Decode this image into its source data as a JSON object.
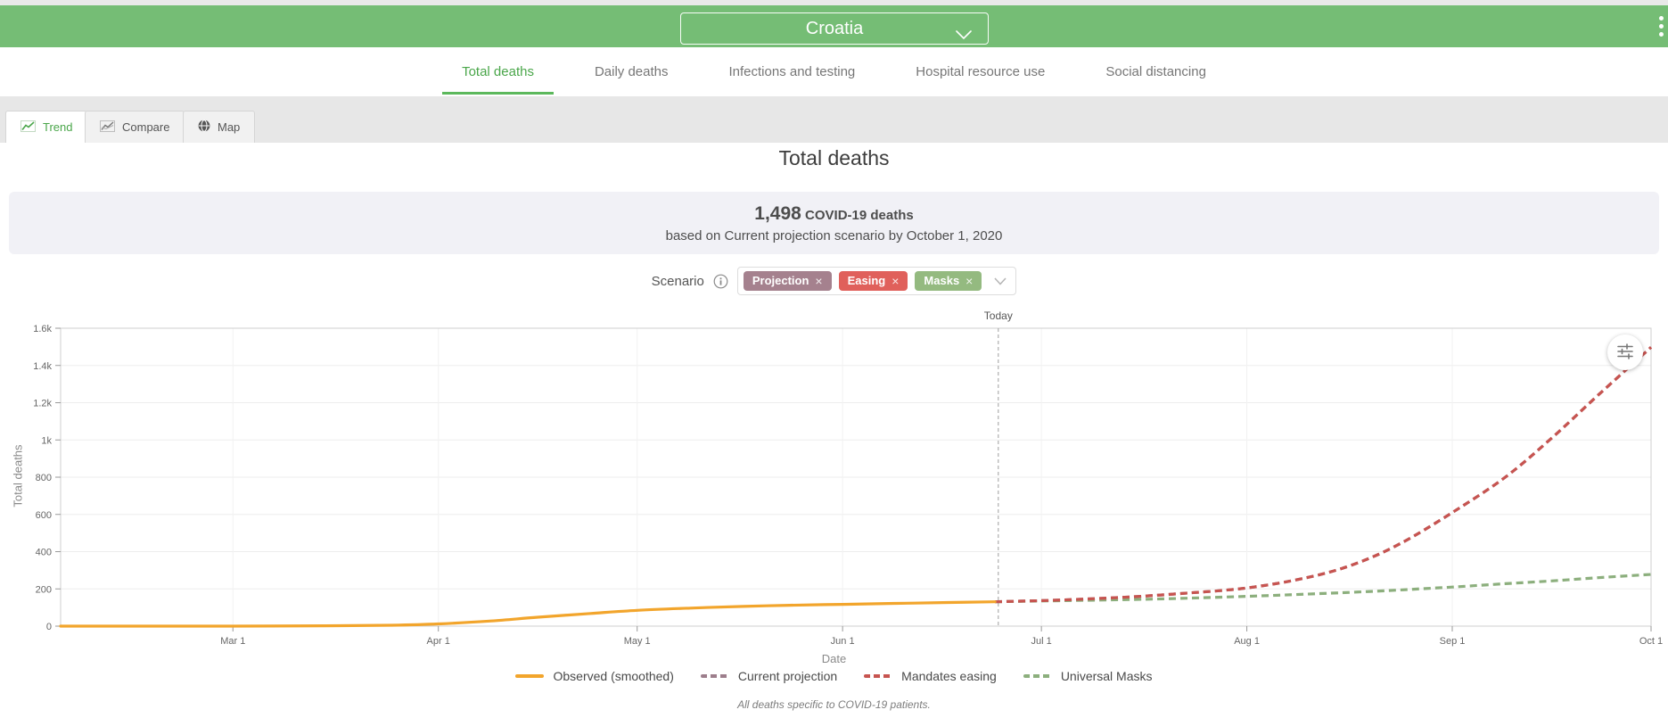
{
  "header": {
    "location_selector": {
      "value": "Croatia"
    }
  },
  "nav_tabs": {
    "items": [
      {
        "label": "Total deaths",
        "active": true
      },
      {
        "label": "Daily deaths",
        "active": false
      },
      {
        "label": "Infections and testing",
        "active": false
      },
      {
        "label": "Hospital resource use",
        "active": false
      },
      {
        "label": "Social distancing",
        "active": false
      }
    ]
  },
  "view_tabs": {
    "items": [
      {
        "label": "Trend",
        "icon": "line-chart-icon",
        "active": true
      },
      {
        "label": "Compare",
        "icon": "compare-chart-icon",
        "active": false
      },
      {
        "label": "Map",
        "icon": "globe-icon",
        "active": false
      }
    ]
  },
  "page": {
    "title": "Total deaths"
  },
  "summary": {
    "value": "1,498",
    "value_label": "COVID-19 deaths",
    "detail": "based on Current projection scenario by October 1, 2020"
  },
  "scenario": {
    "label": "Scenario",
    "close_glyph": "×",
    "tags": [
      {
        "label": "Projection",
        "color": "#a5818e"
      },
      {
        "label": "Easing",
        "color": "#e0605b"
      },
      {
        "label": "Masks",
        "color": "#94ba80"
      }
    ]
  },
  "chart_data": {
    "type": "line",
    "xlabel": "Date",
    "ylabel": "Total deaths",
    "x_unit": "day index (0 = left edge of plot, early Feb 2020)",
    "x_domain_days": [
      0,
      240
    ],
    "ylim": [
      0,
      1600
    ],
    "grid": true,
    "legend_position": "bottom",
    "yticks": [
      {
        "value": 0,
        "label": "0"
      },
      {
        "value": 200,
        "label": "200"
      },
      {
        "value": 400,
        "label": "400"
      },
      {
        "value": 600,
        "label": "600"
      },
      {
        "value": 800,
        "label": "800"
      },
      {
        "value": 1000,
        "label": "1k"
      },
      {
        "value": 1200,
        "label": "1.2k"
      },
      {
        "value": 1400,
        "label": "1.4k"
      },
      {
        "value": 1600,
        "label": "1.6k"
      }
    ],
    "xticks": [
      {
        "day": 26,
        "label": "Mar 1"
      },
      {
        "day": 57,
        "label": "Apr 1"
      },
      {
        "day": 87,
        "label": "May 1"
      },
      {
        "day": 118,
        "label": "Jun 1"
      },
      {
        "day": 148,
        "label": "Jul 1"
      },
      {
        "day": 179,
        "label": "Aug 1"
      },
      {
        "day": 210,
        "label": "Sep 1"
      },
      {
        "day": 240,
        "label": "Oct 1"
      }
    ],
    "today_marker": {
      "day": 141.5,
      "label": "Today"
    },
    "series": [
      {
        "name": "Current projection",
        "color": "#9d7e8c",
        "style": "dashed",
        "points": [
          [
            141,
            131
          ],
          [
            148,
            137
          ],
          [
            155,
            146
          ],
          [
            162,
            158
          ],
          [
            169,
            175
          ],
          [
            179,
            205
          ],
          [
            188,
            260
          ],
          [
            195,
            330
          ],
          [
            202,
            440
          ],
          [
            210,
            610
          ],
          [
            218,
            800
          ],
          [
            225,
            1010
          ],
          [
            232,
            1240
          ],
          [
            240,
            1498
          ]
        ]
      },
      {
        "name": "Universal Masks",
        "color": "#8caf7d",
        "style": "dashed",
        "points": [
          [
            141,
            131
          ],
          [
            148,
            135
          ],
          [
            155,
            139
          ],
          [
            162,
            143
          ],
          [
            169,
            149
          ],
          [
            179,
            160
          ],
          [
            188,
            172
          ],
          [
            195,
            182
          ],
          [
            202,
            194
          ],
          [
            210,
            210
          ],
          [
            218,
            228
          ],
          [
            225,
            243
          ],
          [
            232,
            260
          ],
          [
            240,
            278
          ]
        ]
      },
      {
        "name": "Mandates easing",
        "color": "#c75450",
        "style": "dashed",
        "points": [
          [
            141,
            131
          ],
          [
            148,
            137
          ],
          [
            155,
            146
          ],
          [
            162,
            158
          ],
          [
            169,
            175
          ],
          [
            179,
            205
          ],
          [
            188,
            260
          ],
          [
            195,
            330
          ],
          [
            202,
            440
          ],
          [
            210,
            610
          ],
          [
            218,
            800
          ],
          [
            225,
            1010
          ],
          [
            232,
            1240
          ],
          [
            240,
            1498
          ]
        ]
      },
      {
        "name": "Observed (smoothed)",
        "color": "#f2a52c",
        "style": "solid",
        "points": [
          [
            0,
            0
          ],
          [
            13,
            0
          ],
          [
            26,
            0
          ],
          [
            40,
            2
          ],
          [
            50,
            5
          ],
          [
            57,
            12
          ],
          [
            65,
            28
          ],
          [
            72,
            48
          ],
          [
            80,
            68
          ],
          [
            87,
            85
          ],
          [
            95,
            97
          ],
          [
            103,
            106
          ],
          [
            110,
            112
          ],
          [
            118,
            117
          ],
          [
            126,
            122
          ],
          [
            134,
            127
          ],
          [
            141,
            131
          ]
        ]
      }
    ],
    "legend_order": [
      "Observed (smoothed)",
      "Current projection",
      "Mandates easing",
      "Universal Masks"
    ]
  },
  "chart_footnote": "All deaths specific to COVID-19 patients."
}
